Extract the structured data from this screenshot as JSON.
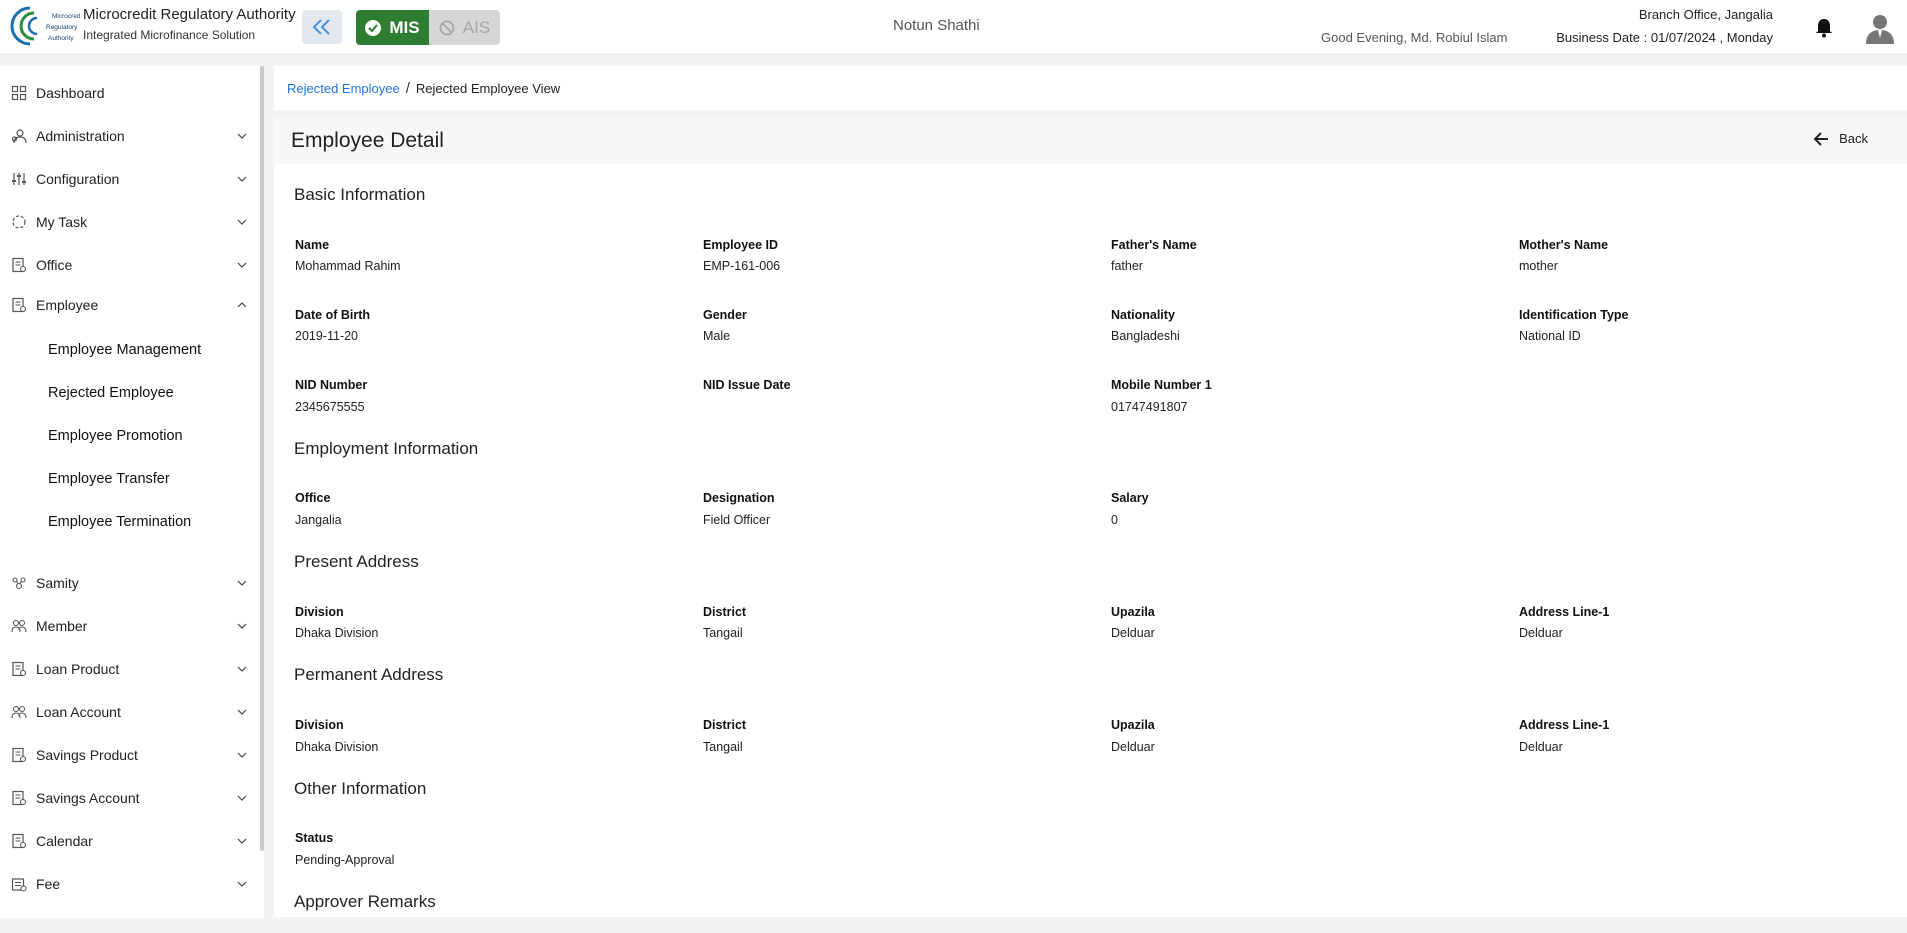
{
  "header": {
    "org_name": "Microcredit Regulatory Authority",
    "org_sub": "Integrated Microfinance Solution",
    "logo_text": "Microcredit Regulatory Authority",
    "mis_label": "MIS",
    "ais_label": "AIS",
    "app_name": "Notun Shathi",
    "greeting": "Good Evening, Md. Robiul Islam",
    "branch": "Branch Office, Jangalia",
    "business_date": "Business Date : 01/07/2024 , Monday"
  },
  "colors": {
    "accent_blue": "#1e73d8",
    "mis_green": "#2e7d32",
    "collapse_chevron": "#4a90e2"
  },
  "sidebar": {
    "items": [
      {
        "label": "Dashboard",
        "icon": "dashboard-icon"
      },
      {
        "label": "Administration",
        "icon": "admin-icon"
      },
      {
        "label": "Configuration",
        "icon": "sliders-icon"
      },
      {
        "label": "My Task",
        "icon": "task-icon"
      },
      {
        "label": "Office",
        "icon": "office-icon"
      },
      {
        "label": "Employee",
        "icon": "employee-icon"
      },
      {
        "label": "Samity",
        "icon": "samity-icon"
      },
      {
        "label": "Member",
        "icon": "member-icon"
      },
      {
        "label": "Loan Product",
        "icon": "loan-product-icon"
      },
      {
        "label": "Loan Account",
        "icon": "loan-account-icon"
      },
      {
        "label": "Savings Product",
        "icon": "savings-product-icon"
      },
      {
        "label": "Savings Account",
        "icon": "savings-account-icon"
      },
      {
        "label": "Calendar",
        "icon": "calendar-icon"
      },
      {
        "label": "Fee",
        "icon": "fee-icon"
      }
    ],
    "employee_sub": [
      "Employee Management",
      "Rejected Employee",
      "Employee Promotion",
      "Employee Transfer",
      "Employee Termination"
    ]
  },
  "breadcrumb": {
    "link": "Rejected Employee",
    "separator": "/",
    "current": "Rejected Employee View"
  },
  "page": {
    "title": "Employee Detail",
    "back_label": "Back"
  },
  "sections": {
    "basic": {
      "title": "Basic Information",
      "fields": [
        {
          "label": "Name",
          "value": "Mohammad Rahim"
        },
        {
          "label": "Employee ID",
          "value": "EMP-161-006"
        },
        {
          "label": "Father's Name",
          "value": "father"
        },
        {
          "label": "Mother's Name",
          "value": "mother"
        },
        {
          "label": "Date of Birth",
          "value": "2019-11-20"
        },
        {
          "label": "Gender",
          "value": "Male"
        },
        {
          "label": "Nationality",
          "value": "Bangladeshi"
        },
        {
          "label": "Identification Type",
          "value": "National ID"
        },
        {
          "label": "NID Number",
          "value": "2345675555"
        },
        {
          "label": "NID Issue Date",
          "value": ""
        },
        {
          "label": "Mobile Number 1",
          "value": "01747491807"
        }
      ]
    },
    "employment": {
      "title": "Employment Information",
      "fields": [
        {
          "label": "Office",
          "value": "Jangalia"
        },
        {
          "label": "Designation",
          "value": "Field Officer"
        },
        {
          "label": "Salary",
          "value": "0"
        }
      ]
    },
    "present": {
      "title": "Present Address",
      "fields": [
        {
          "label": "Division",
          "value": "Dhaka Division"
        },
        {
          "label": "District",
          "value": "Tangail"
        },
        {
          "label": "Upazila",
          "value": "Delduar"
        },
        {
          "label": "Address Line-1",
          "value": "Delduar"
        }
      ]
    },
    "permanent": {
      "title": "Permanent Address",
      "fields": [
        {
          "label": "Division",
          "value": "Dhaka Division"
        },
        {
          "label": "District",
          "value": "Tangail"
        },
        {
          "label": "Upazila",
          "value": "Delduar"
        },
        {
          "label": "Address Line-1",
          "value": "Delduar"
        }
      ]
    },
    "other": {
      "title": "Other Information",
      "fields": [
        {
          "label": "Status",
          "value": "Pending-Approval"
        }
      ]
    },
    "remarks": {
      "title": "Approver Remarks"
    }
  }
}
